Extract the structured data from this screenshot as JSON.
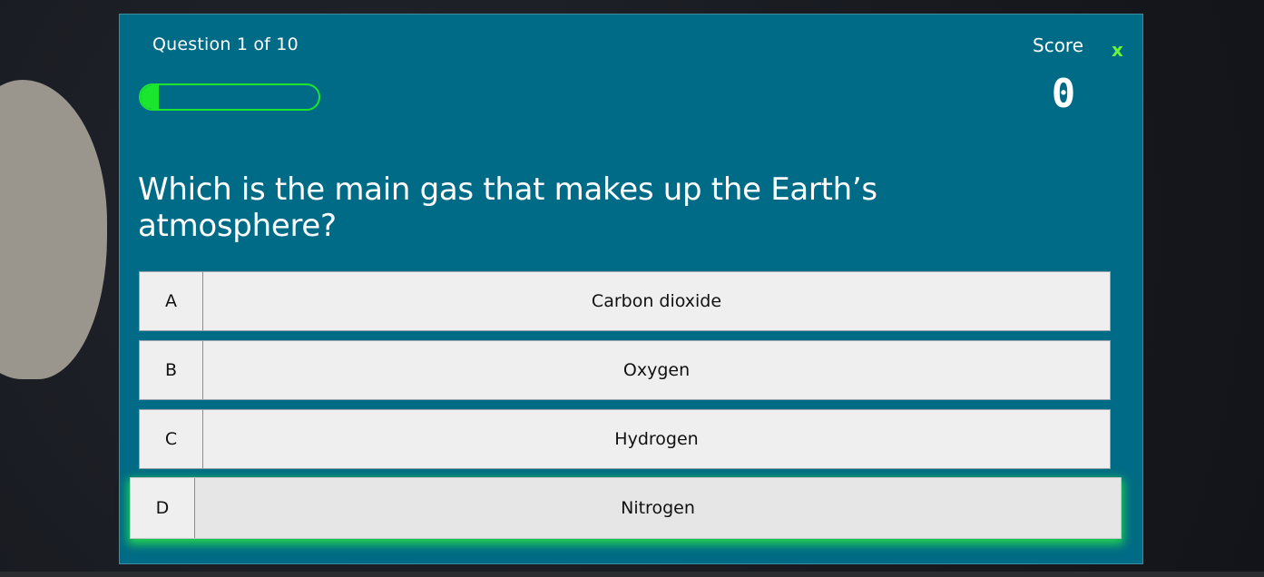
{
  "quiz": {
    "question_counter": "Question 1 of 10",
    "progress": 0.1,
    "score_label": "Score",
    "score_value": "0",
    "close_label": "x",
    "question_text": "Which is the main gas that makes up the Earth’s atmosphere?",
    "answers": [
      {
        "letter": "A",
        "text": "Carbon dioxide"
      },
      {
        "letter": "B",
        "text": "Oxygen"
      },
      {
        "letter": "C",
        "text": "Hydrogen"
      },
      {
        "letter": "D",
        "text": "Nitrogen"
      }
    ],
    "selected_answer": "D"
  },
  "colors": {
    "panel": "#006b86",
    "progress_accent": "#1be62e",
    "close_accent": "#6bf23a",
    "answer_bg": "#efefef",
    "highlight_glow": "#28e646"
  }
}
